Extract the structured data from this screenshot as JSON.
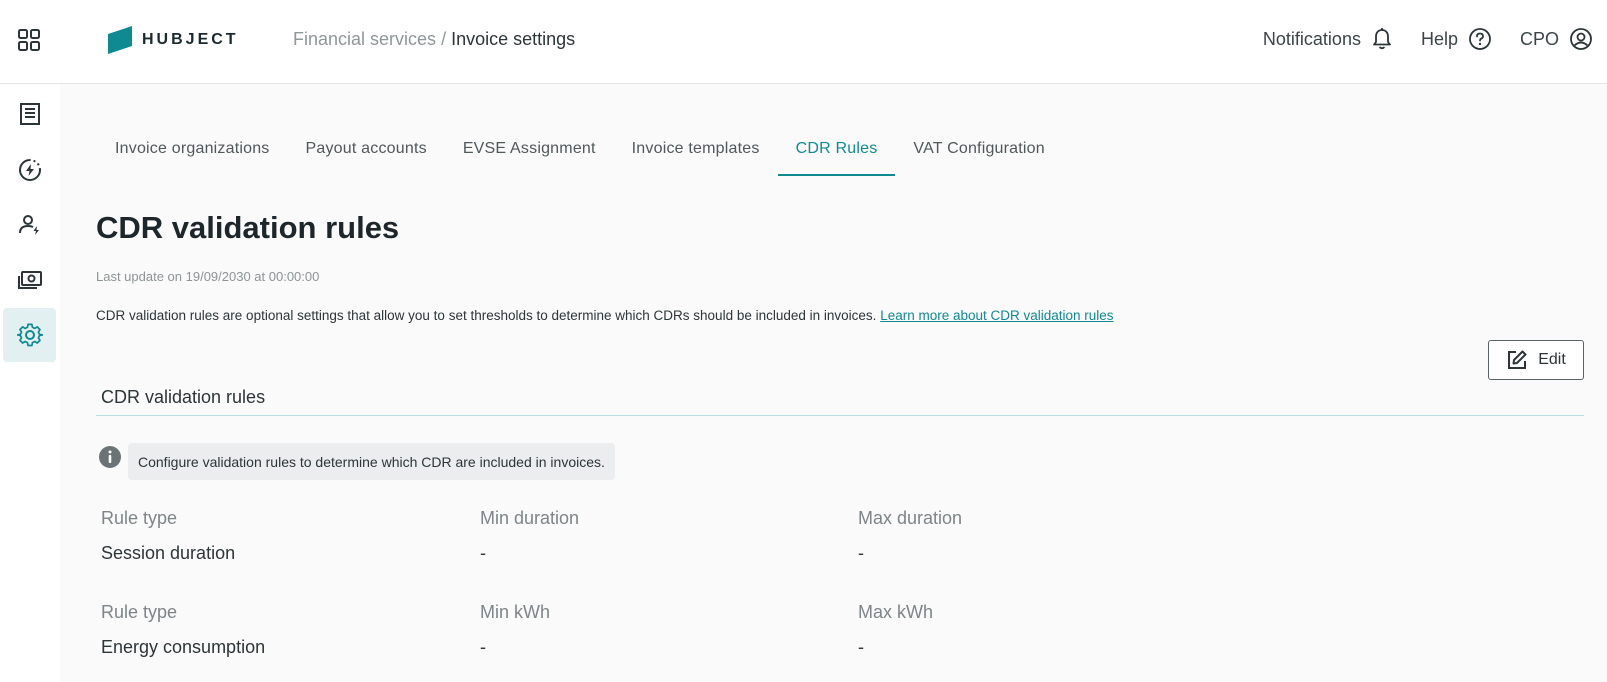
{
  "header": {
    "logo_text": "HUBJECT",
    "breadcrumb_parent": "Financial services",
    "breadcrumb_separator": "/",
    "breadcrumb_current": "Invoice settings",
    "notifications_label": "Notifications",
    "help_label": "Help",
    "user_label": "CPO"
  },
  "sidebar": {
    "items": [
      {
        "icon": "invoice-list-icon"
      },
      {
        "icon": "charging-icon"
      },
      {
        "icon": "user-icon"
      },
      {
        "icon": "money-icon"
      },
      {
        "icon": "gear-icon",
        "active": true
      }
    ]
  },
  "tabs": [
    {
      "label": "Invoice organizations"
    },
    {
      "label": "Payout accounts"
    },
    {
      "label": "EVSE Assignment"
    },
    {
      "label": "Invoice templates"
    },
    {
      "label": "CDR Rules",
      "active": true
    },
    {
      "label": "VAT Configuration"
    }
  ],
  "page": {
    "title": "CDR validation rules",
    "last_update": "Last update on 19/09/2030 at 00:00:00",
    "description": "CDR validation rules are optional settings that allow you to set thresholds to determine which CDRs should be included in invoices.",
    "learn_more_link": "Learn more about CDR validation rules",
    "edit_label": "Edit"
  },
  "section": {
    "title": "CDR validation rules",
    "info": "Configure validation rules to determine which CDR are included in invoices.",
    "rules": [
      {
        "col1_label": "Rule type",
        "col1_value": "Session duration",
        "col2_label": "Min duration",
        "col2_value": "-",
        "col3_label": "Max duration",
        "col3_value": "-"
      },
      {
        "col1_label": "Rule type",
        "col1_value": "Energy consumption",
        "col2_label": "Min kWh",
        "col2_value": "-",
        "col3_label": "Max kWh",
        "col3_value": "-"
      }
    ]
  },
  "colors": {
    "accent": "#0f8a93",
    "logo": "#0f8a93",
    "text_primary": "#212b2e",
    "text_muted": "#7d8588"
  }
}
